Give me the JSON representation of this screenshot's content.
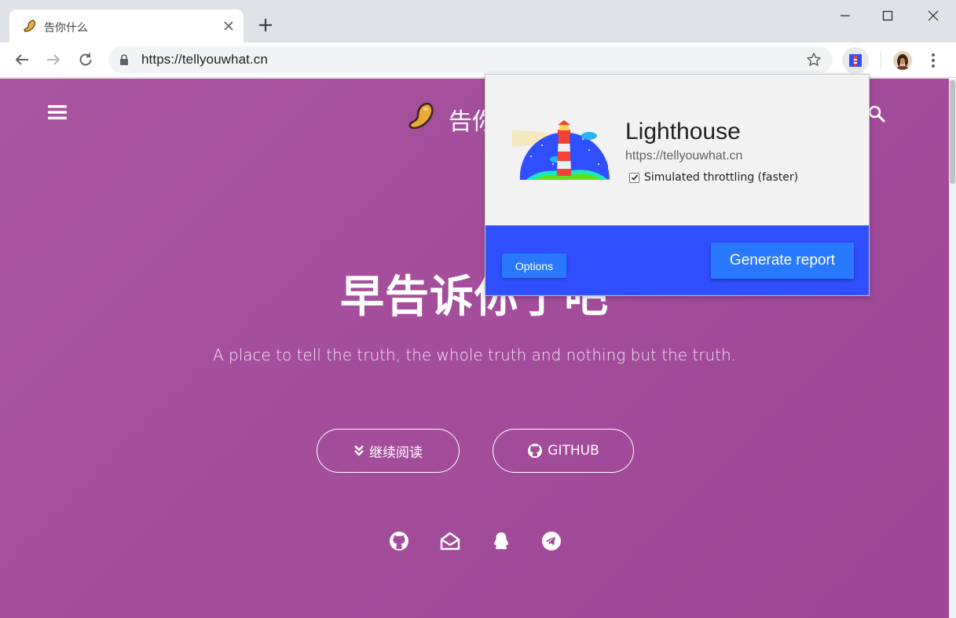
{
  "browser": {
    "tab_title": "告你什么",
    "url": "https://tellyouwhat.cn"
  },
  "site": {
    "logo_text": "告你什么",
    "hero_title": "早告诉你了吧",
    "hero_subtitle": "A place to tell the truth, the whole truth and nothing but the truth.",
    "read_more_label": "继续阅读",
    "github_label": "GITHUB",
    "social_icons": [
      "github-icon",
      "mail-icon",
      "qq-icon",
      "telegram-icon"
    ]
  },
  "lighthouse": {
    "title": "Lighthouse",
    "url": "https://tellyouwhat.cn",
    "throttling_label": "Simulated throttling (faster)",
    "throttling_checked": true,
    "options_label": "Options",
    "generate_label": "Generate report",
    "footer_color": "#304ffe",
    "button_color": "#2979ff"
  },
  "colors": {
    "page_bg": "#a34c9a",
    "tabstrip_bg": "#dee1e6"
  }
}
